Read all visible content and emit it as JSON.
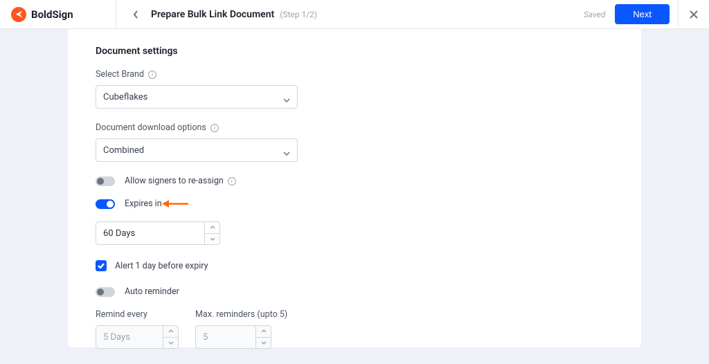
{
  "brand": {
    "name": "BoldSign"
  },
  "header": {
    "title": "Prepare Bulk Link Document",
    "step": "(Step 1/2)",
    "saved": "Saved",
    "next": "Next"
  },
  "settings": {
    "title": "Document settings",
    "selectBrand": {
      "label": "Select Brand",
      "value": "Cubeflakes"
    },
    "download": {
      "label": "Document download options",
      "value": "Combined"
    },
    "reassign": {
      "label": "Allow signers to re-assign"
    },
    "expires": {
      "label": "Expires in",
      "value": "60 Days"
    },
    "alert": {
      "label": "Alert 1 day before expiry"
    },
    "autoReminder": {
      "label": "Auto reminder"
    },
    "remindEvery": {
      "label": "Remind every",
      "value": "5 Days"
    },
    "maxReminders": {
      "label": "Max. reminders (upto 5)",
      "value": "5"
    }
  }
}
